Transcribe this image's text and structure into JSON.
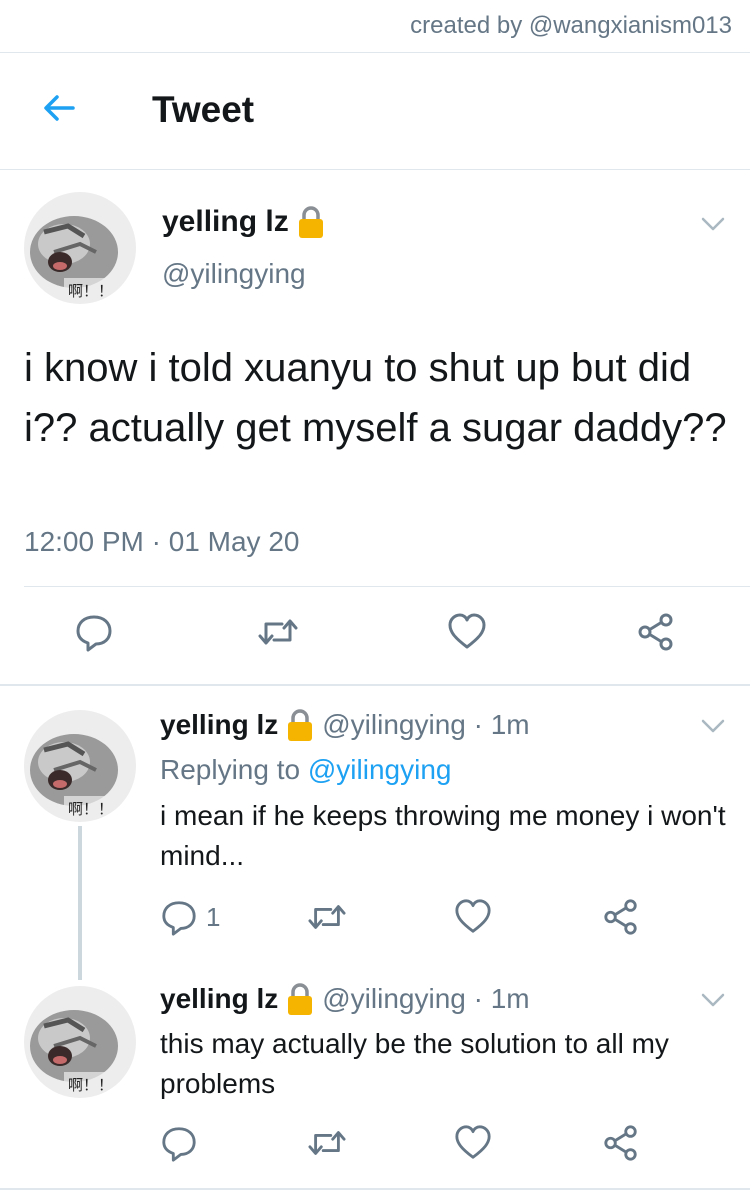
{
  "credit": "created by @wangxianism013",
  "header": {
    "title": "Tweet",
    "back_icon": "arrow-left-icon"
  },
  "colors": {
    "accent": "#1da1f2",
    "muted": "#657786",
    "lock": "#f5b400",
    "divider": "#e1e8ed"
  },
  "main_tweet": {
    "name": "yelling lz",
    "handle": "@yilingying",
    "text": "i know i told xuanyu to shut up but did i?? actually get myself a sugar daddy??",
    "time": "12:00 PM · 01 May 20"
  },
  "avatar_caption": "啊！！",
  "replies": [
    {
      "name": "yelling lz",
      "handle": "@yilingying · 1m",
      "replying_prefix": "Replying to ",
      "replying_to": "@yilingying",
      "text": "i mean if he keeps throwing me money i won't mind...",
      "reply_count": "1"
    },
    {
      "name": "yelling lz",
      "handle": "@yilingying · 1m",
      "text": "this may actually be the solution to all my problems"
    }
  ]
}
